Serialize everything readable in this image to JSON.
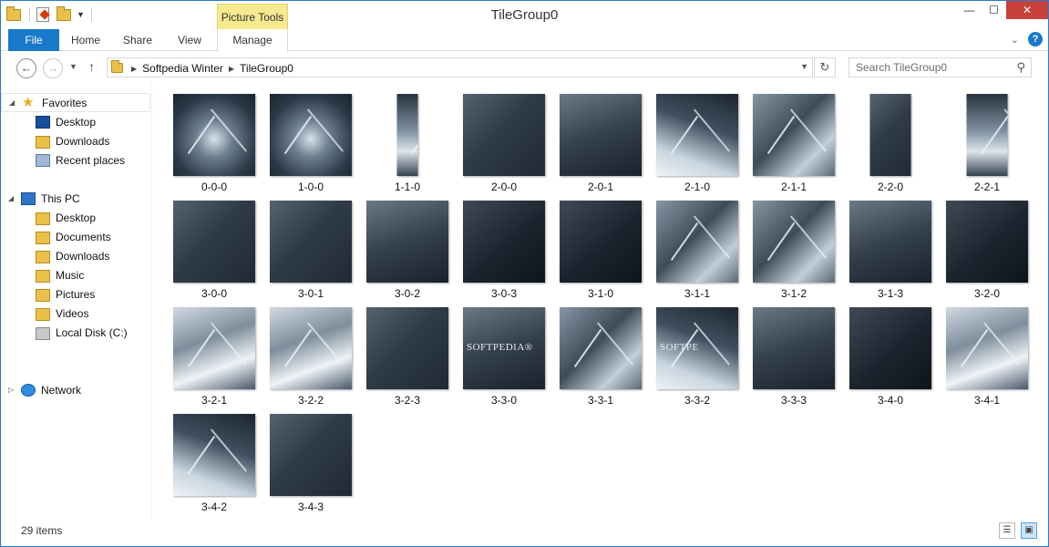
{
  "window": {
    "title": "TileGroup0",
    "context_tab": "Picture Tools"
  },
  "ribbon": {
    "tabs": [
      "File",
      "Home",
      "Share",
      "View",
      "Manage"
    ]
  },
  "address": {
    "crumbs": [
      "Softpedia Winter",
      "TileGroup0"
    ],
    "search_placeholder": "Search TileGroup0"
  },
  "navpane": {
    "favorites": {
      "label": "Favorites",
      "items": [
        "Desktop",
        "Downloads",
        "Recent places"
      ]
    },
    "thispc": {
      "label": "This PC",
      "items": [
        "Desktop",
        "Documents",
        "Downloads",
        "Music",
        "Pictures",
        "Videos",
        "Local Disk (C:)"
      ]
    },
    "network": {
      "label": "Network"
    }
  },
  "files": [
    {
      "name": "0-0-0",
      "shape": "square",
      "tone": "ice1"
    },
    {
      "name": "1-0-0",
      "shape": "square",
      "tone": "ice1"
    },
    {
      "name": "1-1-0",
      "shape": "narrow",
      "tone": "ice2"
    },
    {
      "name": "2-0-0",
      "shape": "square",
      "tone": "dark"
    },
    {
      "name": "2-0-1",
      "shape": "square",
      "tone": "dark2"
    },
    {
      "name": "2-1-0",
      "shape": "square",
      "tone": "ice3"
    },
    {
      "name": "2-1-1",
      "shape": "square",
      "tone": "ice4"
    },
    {
      "name": "2-2-0",
      "shape": "mid",
      "tone": "dark"
    },
    {
      "name": "2-2-1",
      "shape": "mid",
      "tone": "ice2"
    },
    {
      "name": "3-0-0",
      "shape": "square",
      "tone": "dark"
    },
    {
      "name": "3-0-1",
      "shape": "square",
      "tone": "dark"
    },
    {
      "name": "3-0-2",
      "shape": "square",
      "tone": "dark2"
    },
    {
      "name": "3-0-3",
      "shape": "square",
      "tone": "dark3"
    },
    {
      "name": "3-1-0",
      "shape": "square",
      "tone": "dark3"
    },
    {
      "name": "3-1-1",
      "shape": "square",
      "tone": "ice4"
    },
    {
      "name": "3-1-2",
      "shape": "square",
      "tone": "ice4"
    },
    {
      "name": "3-1-3",
      "shape": "square",
      "tone": "dark2"
    },
    {
      "name": "3-2-0",
      "shape": "square",
      "tone": "dark3"
    },
    {
      "name": "3-2-1",
      "shape": "square",
      "tone": "ice5"
    },
    {
      "name": "3-2-2",
      "shape": "square",
      "tone": "ice5"
    },
    {
      "name": "3-2-3",
      "shape": "square",
      "tone": "dark"
    },
    {
      "name": "3-3-0",
      "shape": "square",
      "tone": "dark2",
      "watermark": "SOFTPEDIA®"
    },
    {
      "name": "3-3-1",
      "shape": "square",
      "tone": "ice4"
    },
    {
      "name": "3-3-2",
      "shape": "square",
      "tone": "ice3",
      "watermark": "SOFTPE"
    },
    {
      "name": "3-3-3",
      "shape": "square",
      "tone": "dark2"
    },
    {
      "name": "3-4-0",
      "shape": "square",
      "tone": "dark3"
    },
    {
      "name": "3-4-1",
      "shape": "square",
      "tone": "ice5"
    },
    {
      "name": "3-4-2",
      "shape": "square",
      "tone": "ice3"
    },
    {
      "name": "3-4-3",
      "shape": "square",
      "tone": "dark"
    }
  ],
  "status": {
    "item_count": "29 items"
  },
  "colors": {
    "accent": "#1979ca",
    "context_tab": "#f7e98e",
    "close_button": "#c7423a"
  }
}
